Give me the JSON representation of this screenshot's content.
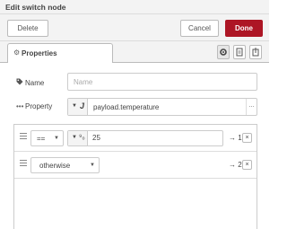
{
  "dialog": {
    "title": "Edit switch node",
    "delete_label": "Delete",
    "cancel_label": "Cancel",
    "done_label": "Done",
    "accent_color": "#ad1625"
  },
  "tabs": {
    "properties_label": "Properties",
    "properties_icon": "gear-icon",
    "side_buttons": [
      "gear-icon",
      "document-icon",
      "export-icon"
    ]
  },
  "form": {
    "name_label": "Name",
    "name_placeholder": "Name",
    "name_value": "",
    "property_label": "Property",
    "property_type_icon": "J",
    "property_value": "payload.temperature",
    "property_more": "…"
  },
  "rules": [
    {
      "operator": "==",
      "value_type_icon": "⁹₀",
      "value": "25",
      "output": "→ 1",
      "delete": "×"
    },
    {
      "operator": "otherwise",
      "output": "→ 2",
      "delete": "×"
    }
  ]
}
